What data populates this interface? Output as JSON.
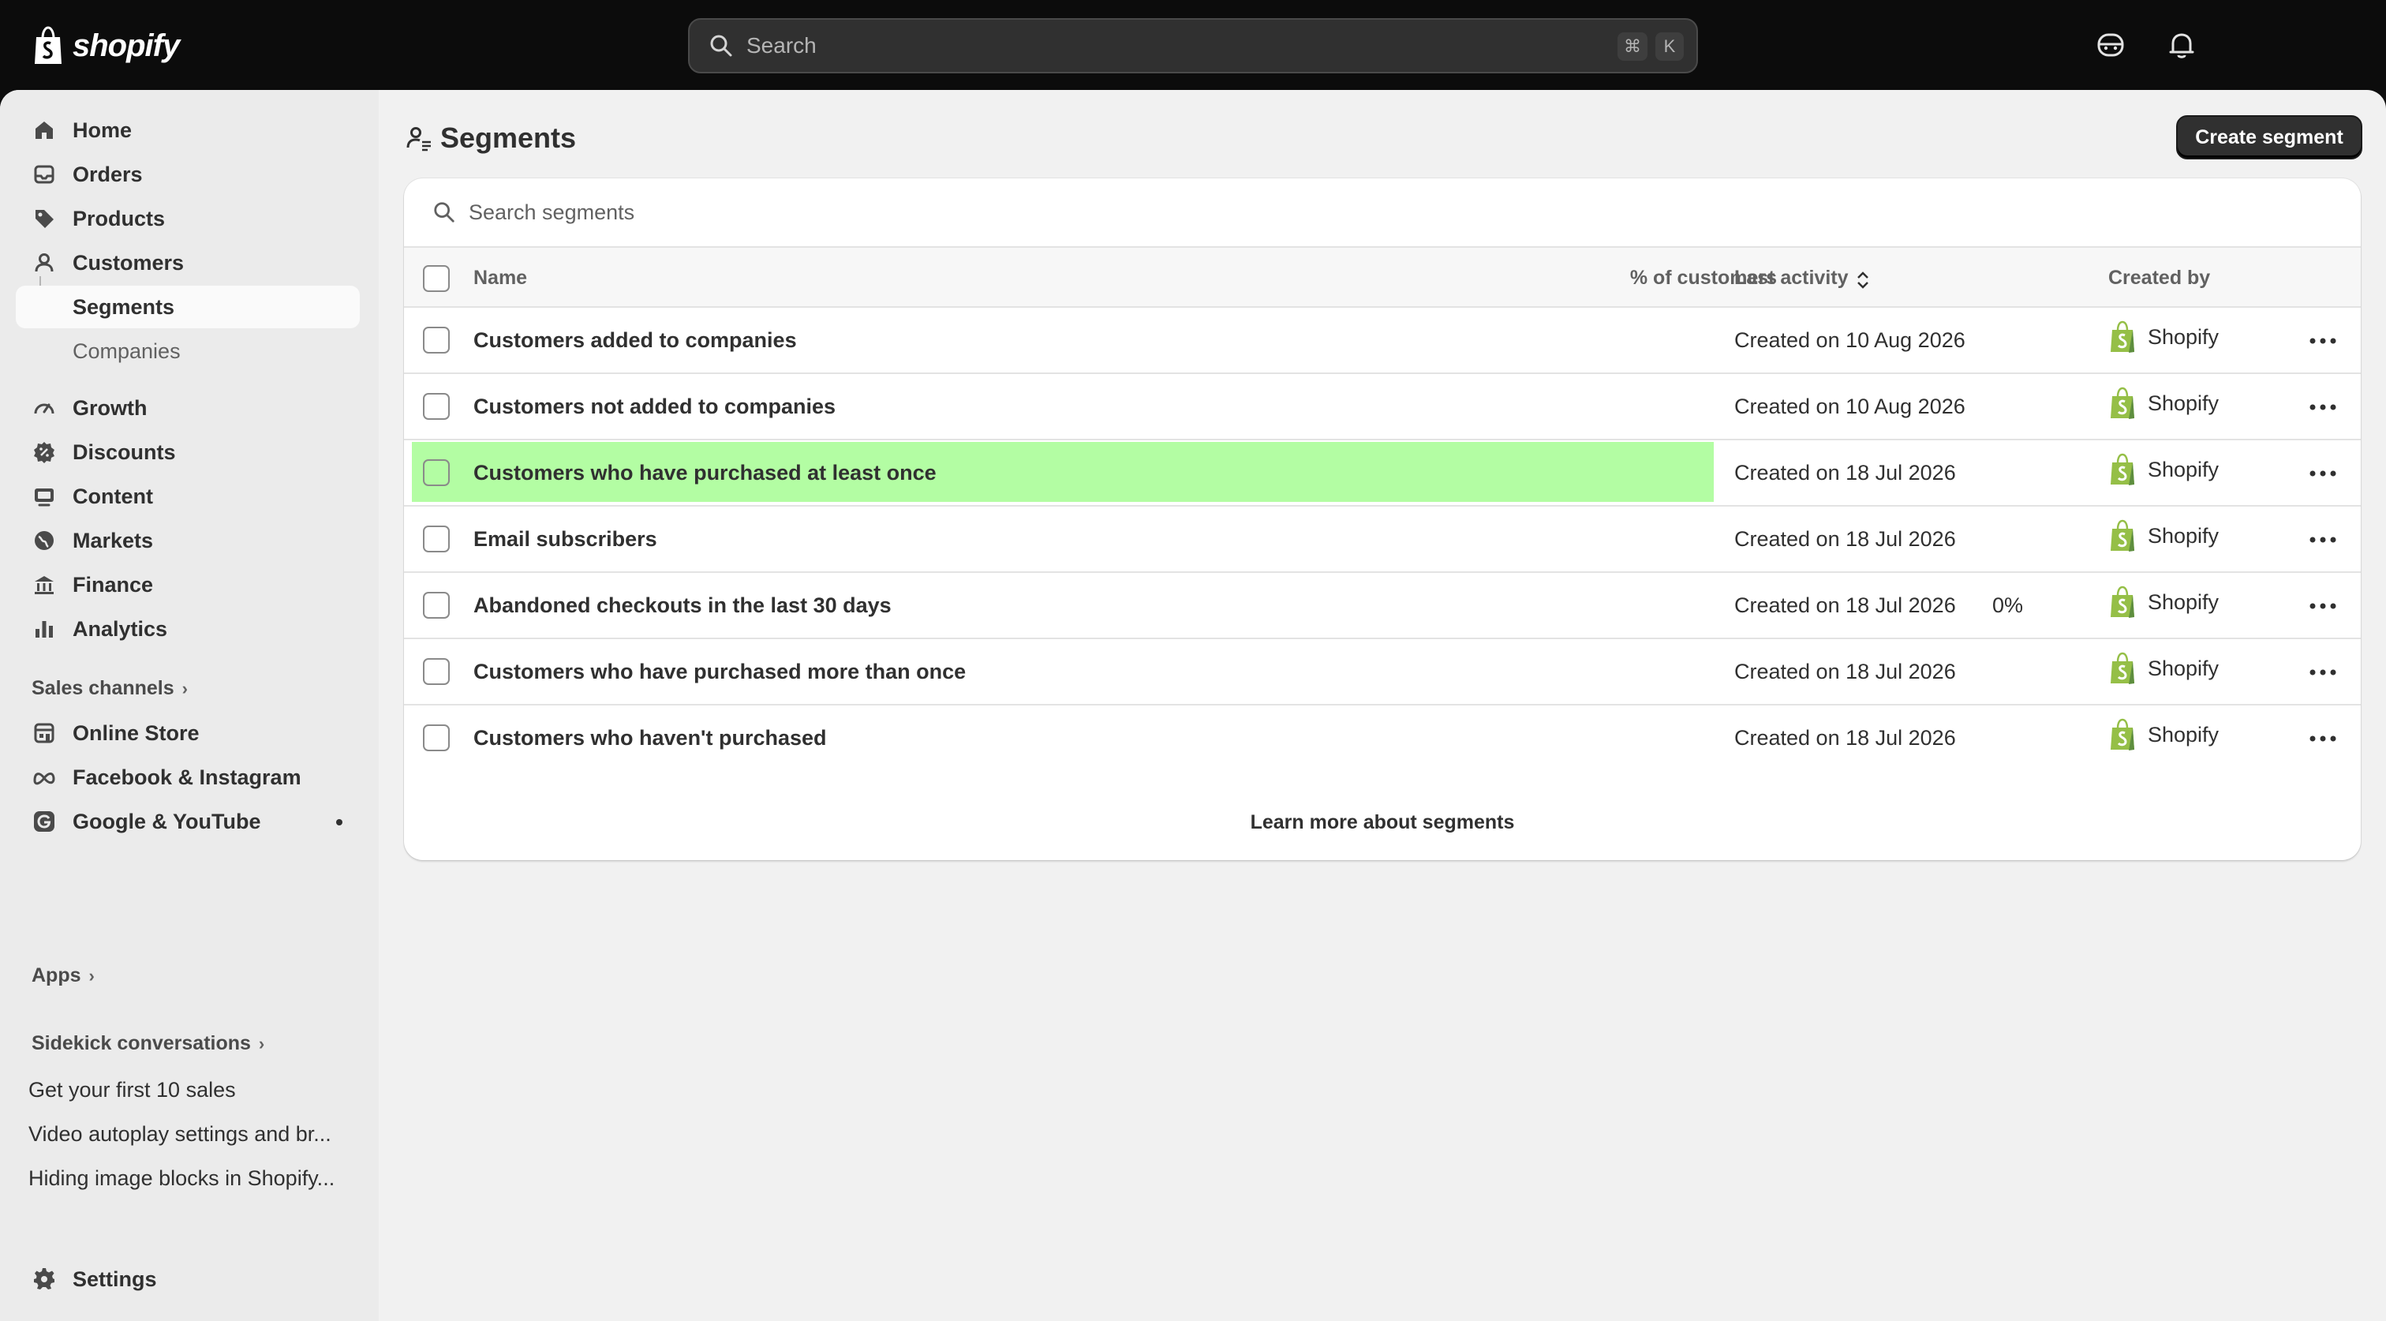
{
  "topbar": {
    "brand": "shopify",
    "search_placeholder": "Search",
    "shortcut_mod": "⌘",
    "shortcut_key": "K"
  },
  "sidebar": {
    "items": [
      {
        "label": "Home",
        "icon": "home-icon"
      },
      {
        "label": "Orders",
        "icon": "orders-icon"
      },
      {
        "label": "Products",
        "icon": "tag-icon"
      },
      {
        "label": "Customers",
        "icon": "person-icon"
      },
      {
        "label": "Segments",
        "icon": ""
      },
      {
        "label": "Companies",
        "icon": ""
      },
      {
        "label": "Growth",
        "icon": "gauge-icon"
      },
      {
        "label": "Discounts",
        "icon": "discount-icon"
      },
      {
        "label": "Content",
        "icon": "content-icon"
      },
      {
        "label": "Markets",
        "icon": "globe-icon"
      },
      {
        "label": "Finance",
        "icon": "bank-icon"
      },
      {
        "label": "Analytics",
        "icon": "bar-chart-icon"
      }
    ],
    "sales_channels_title": "Sales channels",
    "channels": [
      {
        "label": "Online Store",
        "icon": "store-icon"
      },
      {
        "label": "Facebook & Instagram",
        "icon": "meta-icon"
      },
      {
        "label": "Google & YouTube",
        "icon": "google-icon"
      }
    ],
    "apps_title": "Apps",
    "sidekick_title": "Sidekick conversations",
    "conversations": [
      "Get your first 10 sales",
      "Video autoplay settings and br...",
      "Hiding image blocks in Shopify..."
    ],
    "settings_label": "Settings"
  },
  "main": {
    "title": "Segments",
    "create_button": "Create segment",
    "search_placeholder": "Search segments",
    "columns": {
      "name": "Name",
      "percent": "% of customers",
      "last_activity": "Last activity",
      "created_by": "Created by"
    },
    "rows": [
      {
        "name": "Customers added to companies",
        "percent": "",
        "activity": "Created on 10 Aug 2026",
        "creator": "Shopify"
      },
      {
        "name": "Customers not added to companies",
        "percent": "",
        "activity": "Created on 10 Aug 2026",
        "creator": "Shopify"
      },
      {
        "name": "Customers who have purchased at least once",
        "percent": "",
        "activity": "Created on 18 Jul 2026",
        "creator": "Shopify"
      },
      {
        "name": "Email subscribers",
        "percent": "",
        "activity": "Created on 18 Jul 2026",
        "creator": "Shopify"
      },
      {
        "name": "Abandoned checkouts in the last 30 days",
        "percent": "0%",
        "activity": "Created on 18 Jul 2026",
        "creator": "Shopify"
      },
      {
        "name": "Customers who have purchased more than once",
        "percent": "",
        "activity": "Created on 18 Jul 2026",
        "creator": "Shopify"
      },
      {
        "name": "Customers who haven't purchased",
        "percent": "",
        "activity": "Created on 18 Jul 2026",
        "creator": "Shopify"
      }
    ],
    "highlight_color": "#b3fda3",
    "learn_more": "Learn more about segments"
  },
  "colors": {
    "topbar": "#0c0c0c",
    "sidebar": "#ebebeb",
    "canvas": "#f1f1f1",
    "brand_green": "#95bf47",
    "primary_button": "#303030"
  }
}
